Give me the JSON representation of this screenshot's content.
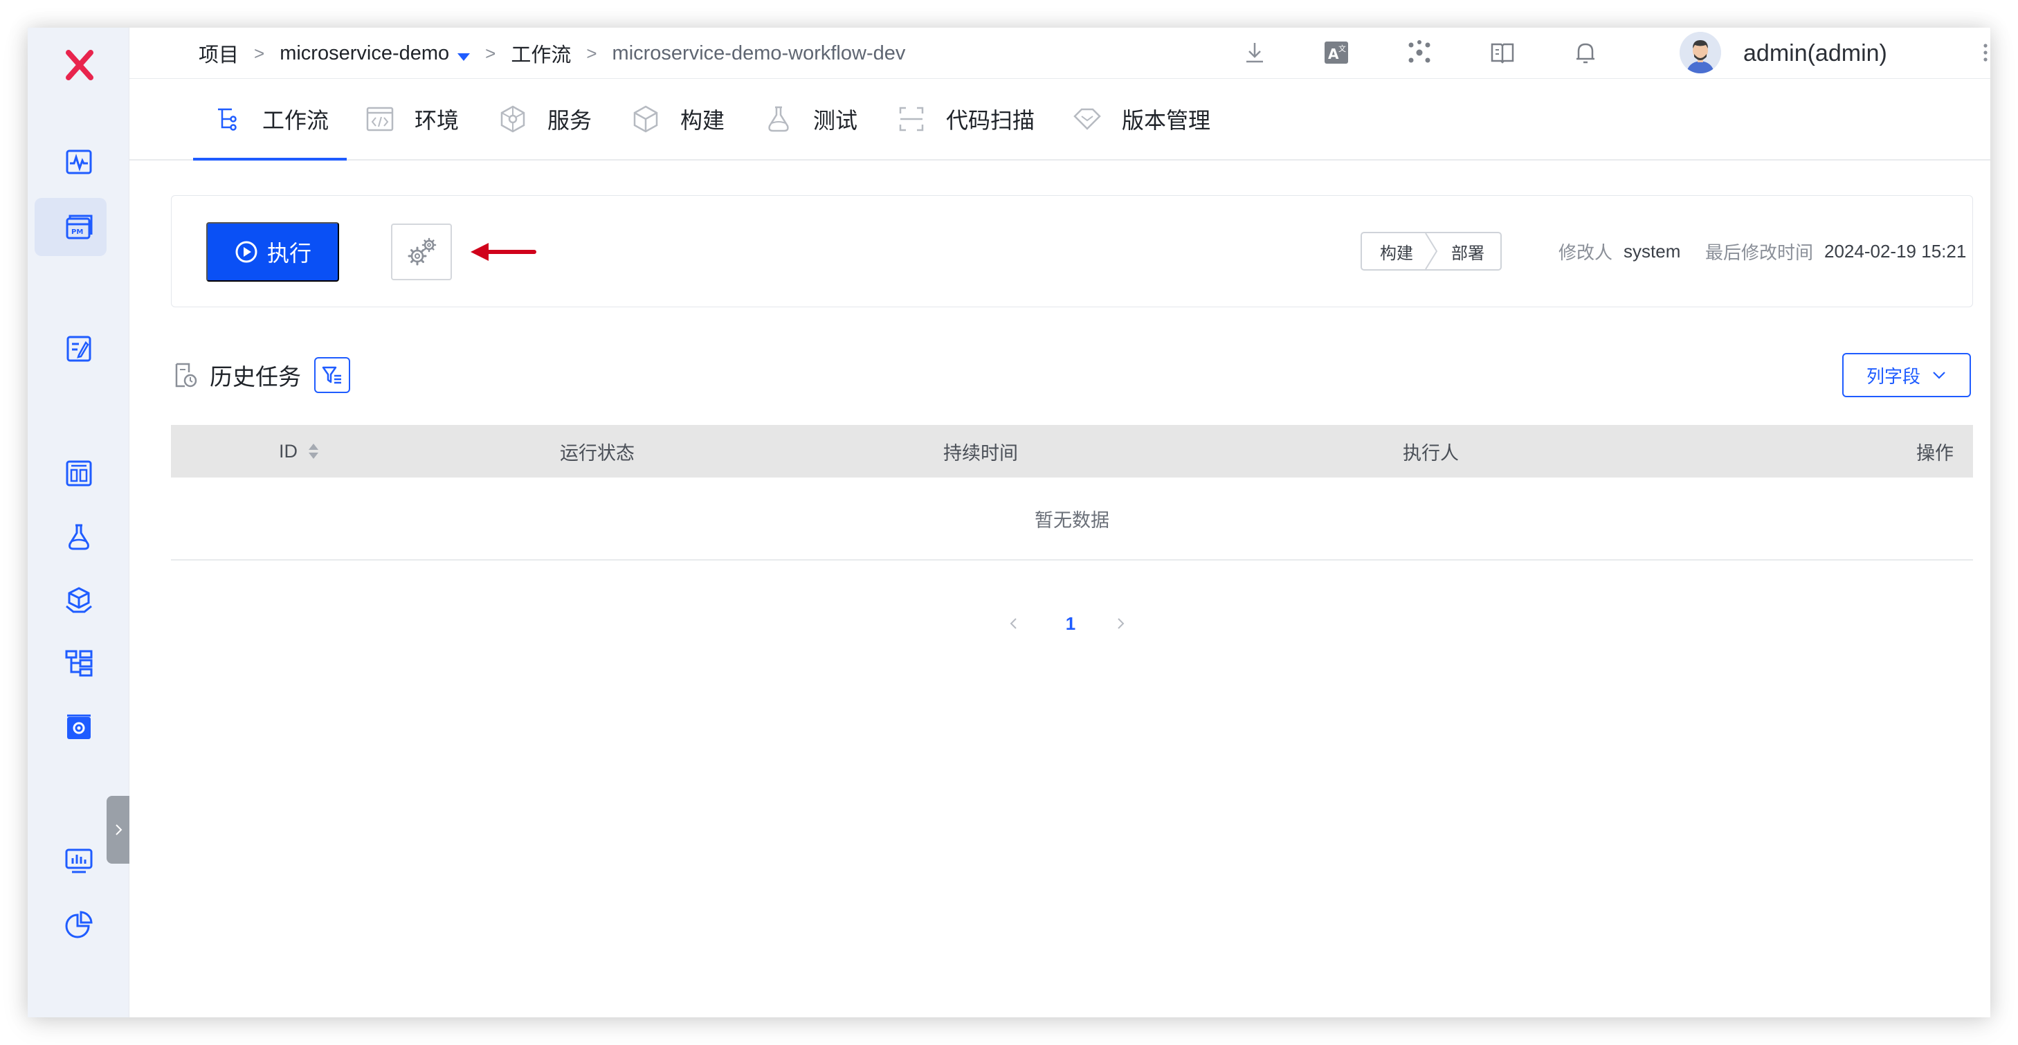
{
  "app": {
    "logo_icon": "zadig-x-logo-icon",
    "accent_color": "#1f5cff",
    "brand_color": "#e8244d"
  },
  "sidebar": {
    "icons": [
      "pulse-monitor-icon",
      "pm-projects-icon",
      "release-plan-icon",
      "dashboard-icon",
      "flask-test-icon",
      "package-hands-icon",
      "workflow-tree-icon",
      "settings-box-icon",
      "monitor-chart-icon",
      "pie-chart-icon"
    ],
    "active_index": 1,
    "collapse_icon": "chevron-right-icon"
  },
  "topbar": {
    "breadcrumb": {
      "project_label": "项目",
      "project_name": "microservice-demo",
      "section_label": "工作流",
      "current": "microservice-demo-workflow-dev",
      "separator": ">"
    },
    "icons": [
      "download-icon",
      "translate-icon",
      "network-icon",
      "book-icon",
      "bell-icon"
    ],
    "user": {
      "display_name": "admin(admin)",
      "avatar_icon": "avatar-icon"
    },
    "more_icon": "more-vertical-icon"
  },
  "tabs": [
    {
      "label": "工作流",
      "icon": "workflow-icon",
      "active": true
    },
    {
      "label": "环境",
      "icon": "code-env-icon",
      "active": false
    },
    {
      "label": "服务",
      "icon": "service-cube-icon",
      "active": false
    },
    {
      "label": "构建",
      "icon": "build-cube-icon",
      "active": false
    },
    {
      "label": "测试",
      "icon": "flask-icon",
      "active": false
    },
    {
      "label": "代码扫描",
      "icon": "scan-icon",
      "active": false
    },
    {
      "label": "版本管理",
      "icon": "version-diamond-icon",
      "active": false
    }
  ],
  "actions": {
    "run_label": "执行",
    "run_icon": "play-circle-icon",
    "settings_icon": "gear-icon",
    "arrow_color": "#d0021b",
    "stages": [
      "构建",
      "部署"
    ],
    "modifier_label": "修改人",
    "modifier_value": "system",
    "modified_time_label": "最后修改时间",
    "modified_time_value": "2024-02-19 15:21"
  },
  "history": {
    "title": "历史任务",
    "title_icon": "history-doc-icon",
    "filter_icon": "filter-icon",
    "fields_button_label": "列字段",
    "columns": [
      "ID",
      "运行状态",
      "持续时间",
      "执行人",
      "操作"
    ],
    "empty_text": "暂无数据",
    "pagination": {
      "current_page": "1"
    }
  }
}
